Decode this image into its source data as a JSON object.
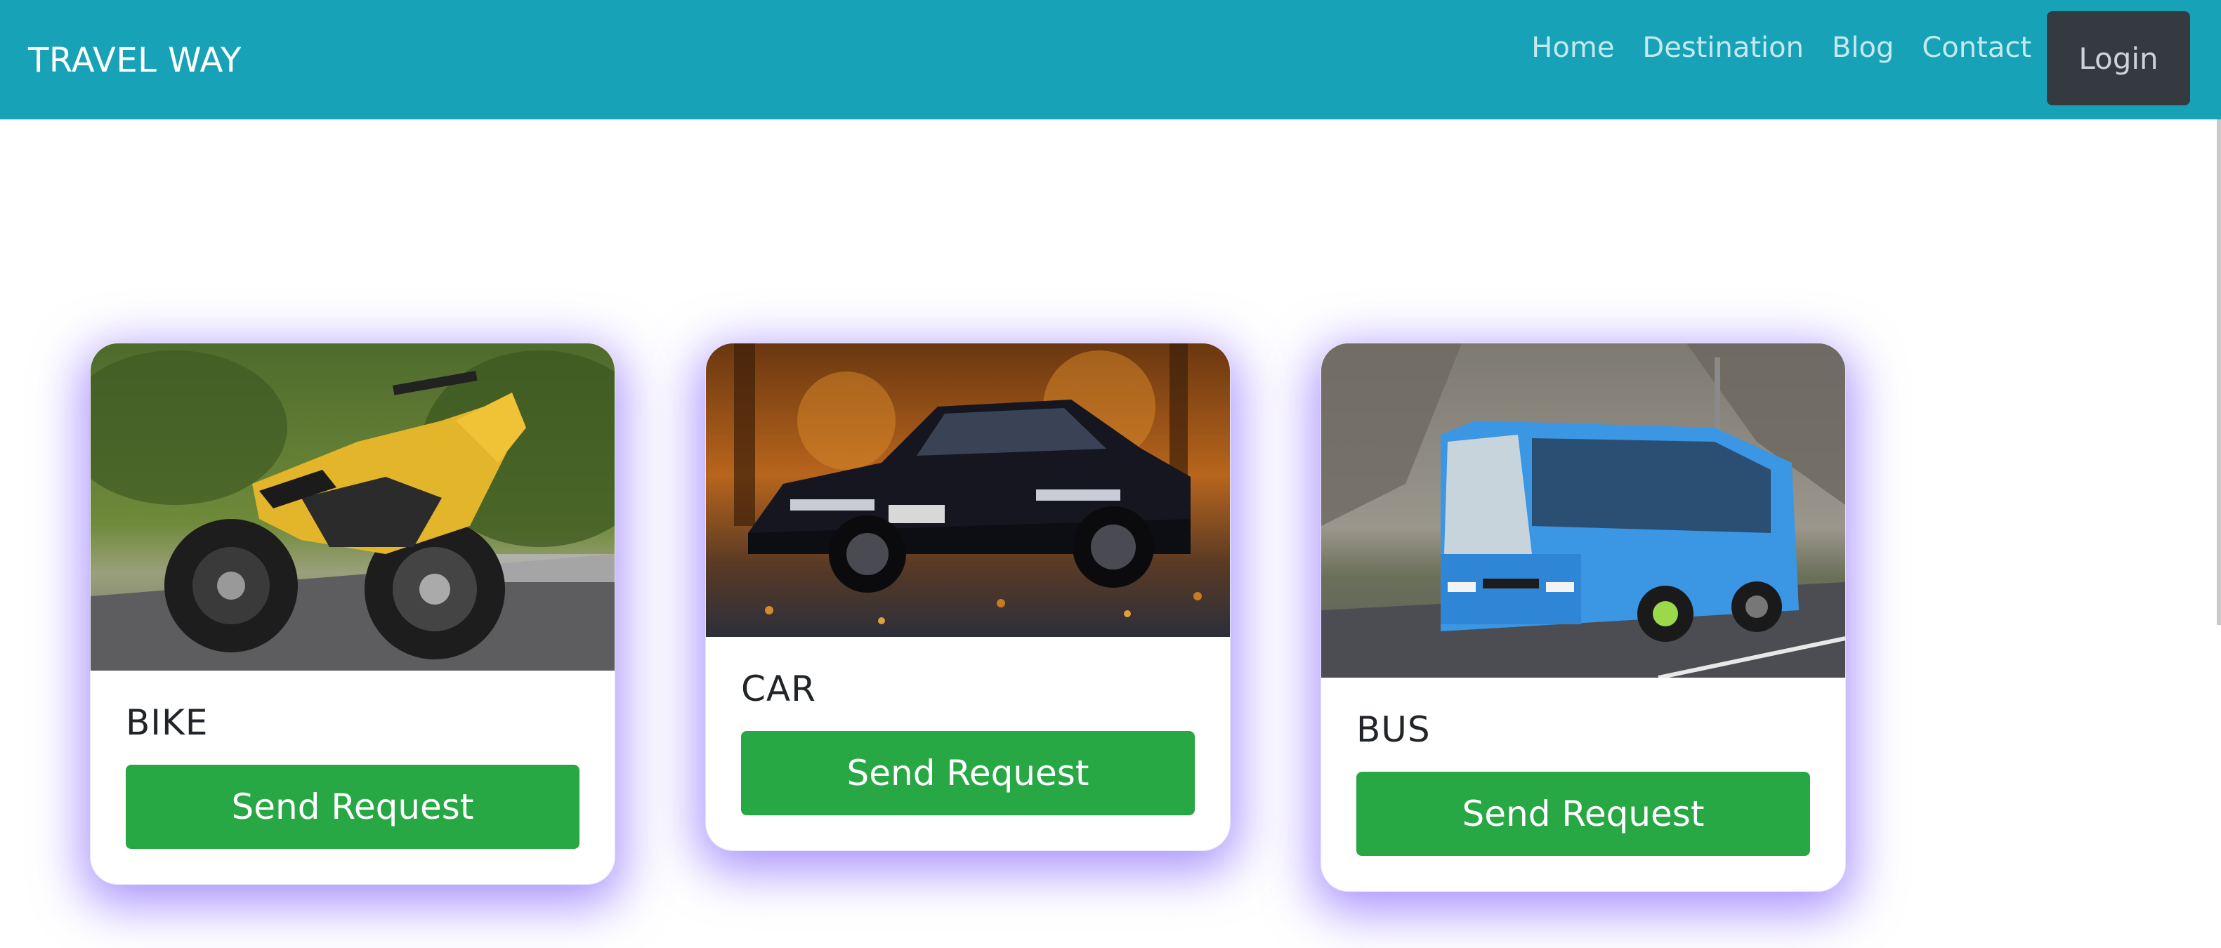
{
  "header": {
    "brand": "TRAVEL WAY",
    "nav": [
      {
        "label": "Home"
      },
      {
        "label": "Destination"
      },
      {
        "label": "Blog"
      },
      {
        "label": "Contact"
      }
    ],
    "login_label": "Login"
  },
  "cards": [
    {
      "title": "BIKE",
      "button_label": "Send Request"
    },
    {
      "title": "CAR",
      "button_label": "Send Request"
    },
    {
      "title": "BUS",
      "button_label": "Send Request"
    }
  ],
  "colors": {
    "navbar": "#17a2b8",
    "login": "#343a40",
    "button": "#28a745",
    "card_glow": "#8c6eff"
  }
}
